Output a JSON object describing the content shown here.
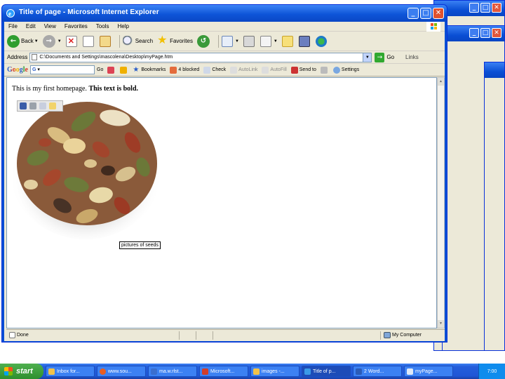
{
  "window": {
    "title": "Title of page - Microsoft Internet Explorer"
  },
  "menu": [
    "File",
    "Edit",
    "View",
    "Favorites",
    "Tools",
    "Help"
  ],
  "toolbar": {
    "back_label": "Back",
    "search_label": "Search",
    "favorites_label": "Favorites"
  },
  "address": {
    "label": "Address",
    "value": "C:\\Documents and Settings\\mascolena\\Desktop\\myPage.htm",
    "go_label": "Go",
    "links_label": "Links"
  },
  "google_bar": {
    "logo": "Google",
    "search_value": "G",
    "go_label": "Go",
    "bookmarks_label": "Bookmarks",
    "blocked_label": "4 blocked",
    "check_label": "Check",
    "autolink_label": "AutoLink",
    "autofill_label": "AutoFill",
    "sendto_label": "Send to",
    "settings_label": "Settings"
  },
  "page": {
    "text_normal": "This is my first homepage. ",
    "text_bold": "This text is bold.",
    "image_caption": "pictures of seeds"
  },
  "status": {
    "done": "Done",
    "zone": "My Computer"
  },
  "taskbar": {
    "start_label": "start",
    "items": [
      "Inbox for...",
      "www.sou...",
      "ma.w.rlst...",
      "Microsoft...",
      "images -...",
      "Title of p...",
      "2 Word...",
      "myPage..."
    ],
    "clock": "7:00"
  }
}
